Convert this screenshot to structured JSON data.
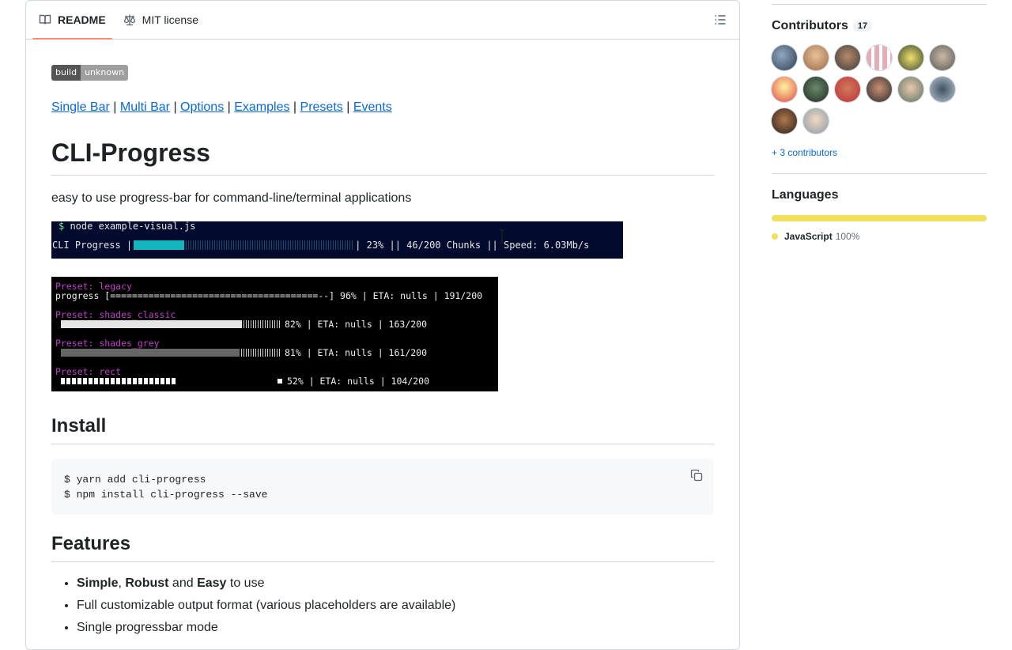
{
  "tabs": {
    "readme": "README",
    "license": "MIT license"
  },
  "icons": {
    "readme": "book-icon",
    "license": "scale-icon",
    "toc": "list-unordered-icon",
    "copy": "copy-icon"
  },
  "badge": {
    "label": "build",
    "value": "unknown"
  },
  "nav_links": [
    "Single Bar",
    "Multi Bar",
    "Options",
    "Examples",
    "Presets",
    "Events"
  ],
  "title": "CLI-Progress",
  "description": "easy to use progress-bar for command-line/terminal applications",
  "terminal1": {
    "prompt": "$",
    "command": " node example-visual.js",
    "bar_prefix": "CLI Progress |",
    "progress": 0.23,
    "bar_suffix": "| 23% || 46/200 Chunks || Speed: 6.03Mb/s"
  },
  "terminal2": {
    "legacy_label": "Preset: legacy",
    "legacy_line": "progress [======================================--] 96% | ETA: nulls | 191/200",
    "classic_label": "Preset: shades_classic",
    "classic_progress": 0.82,
    "classic_suffix": "82% | ETA: nulls | 163/200",
    "grey_label": "Preset: shades_grey",
    "grey_progress": 0.81,
    "grey_suffix": "81% | ETA: nulls | 161/200",
    "rect_label": "Preset: rect",
    "rect_progress": 0.52,
    "rect_suffix": "52% | ETA: nulls | 104/200"
  },
  "install": {
    "heading": "Install",
    "line1": "$ yarn add cli-progress",
    "line2": "$ npm install cli-progress --save"
  },
  "features": {
    "heading": "Features",
    "item1": {
      "b1": "Simple",
      "sep1": ", ",
      "b2": "Robust",
      "sep2": " and ",
      "b3": "Easy",
      "rest": " to use"
    },
    "item2": "Full customizable output format (various placeholders are available)",
    "item3": "Single progressbar mode"
  },
  "sidebar": {
    "contributors_heading": "Contributors",
    "contributors_count": "17",
    "more_contributors": "+ 3 contributors",
    "languages_heading": "Languages",
    "languages": [
      {
        "name": "JavaScript",
        "percent": "100%",
        "color": "#f1e05a"
      }
    ]
  }
}
